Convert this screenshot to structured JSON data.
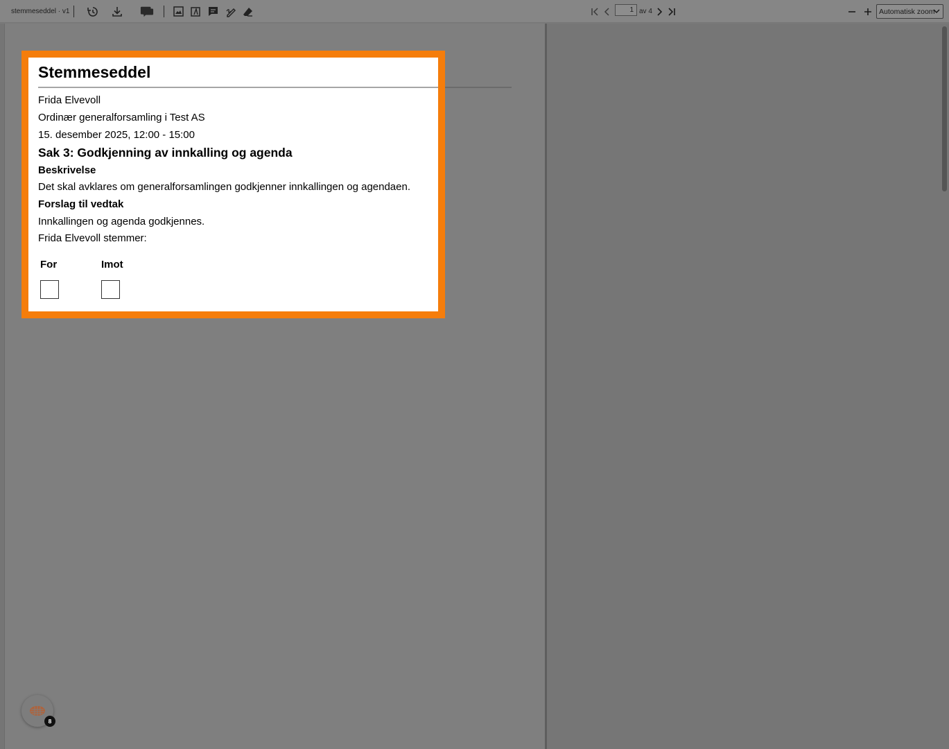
{
  "toolbar": {
    "document_name": "stemmeseddel · v1",
    "page_current": "1",
    "page_total_label": "av 4",
    "zoom_label": "Automatisk zoom",
    "icons": [
      "history-icon",
      "download-icon",
      "comments-icon",
      "insert-image-icon",
      "insert-text-icon",
      "comment-icon",
      "signature-icon",
      "eraser-icon",
      "first-page-icon",
      "prev-page-icon",
      "next-page-icon",
      "last-page-icon",
      "zoom-out-icon",
      "zoom-in-icon"
    ]
  },
  "ballot": {
    "title": "Stemmeseddel",
    "voter_name": "Frida Elvevoll",
    "meeting": "Ordinær generalforsamling i Test AS",
    "datetime": "15. desember 2025, 12:00 - 15:00",
    "case_title": "Sak 3: Godkjenning av innkalling og agenda",
    "description_heading": "Beskrivelse",
    "description": "Det skal avklares om generalforsamlingen godkjenner innkallingen og agendaen.",
    "proposal_heading": "Forslag til vedtak",
    "proposal": "Innkallingen og agenda godkjennes.",
    "vote_prompt": "Frida Elvevoll stemmer:",
    "options": [
      {
        "label": "For",
        "checked": false
      },
      {
        "label": "Imot",
        "checked": false
      }
    ]
  },
  "assistant": {
    "badge_count": "8",
    "icon": "brain-icon"
  },
  "colors": {
    "highlight": "#f57d0b",
    "background": "#7f7f7f"
  }
}
